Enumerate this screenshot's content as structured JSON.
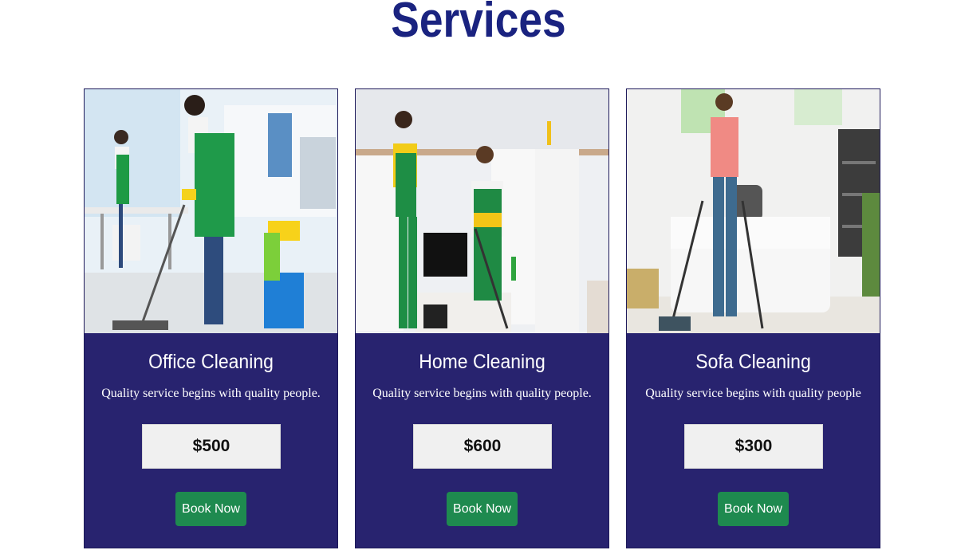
{
  "page": {
    "title": "Services"
  },
  "cards": [
    {
      "title": "Office Cleaning",
      "description": "Quality service begins with quality people.",
      "price": "$500",
      "button": "Book Now"
    },
    {
      "title": "Home Cleaning",
      "description": "Quality service begins with quality people.",
      "price": "$600",
      "button": "Book Now"
    },
    {
      "title": "Sofa Cleaning",
      "description": "Quality service begins with quality people",
      "price": "$300",
      "button": "Book Now"
    }
  ],
  "colors": {
    "heading": "#1a2380",
    "card_bg": "#28236f",
    "button_bg": "#1e8a4f",
    "price_bg": "#f0f0f0"
  }
}
